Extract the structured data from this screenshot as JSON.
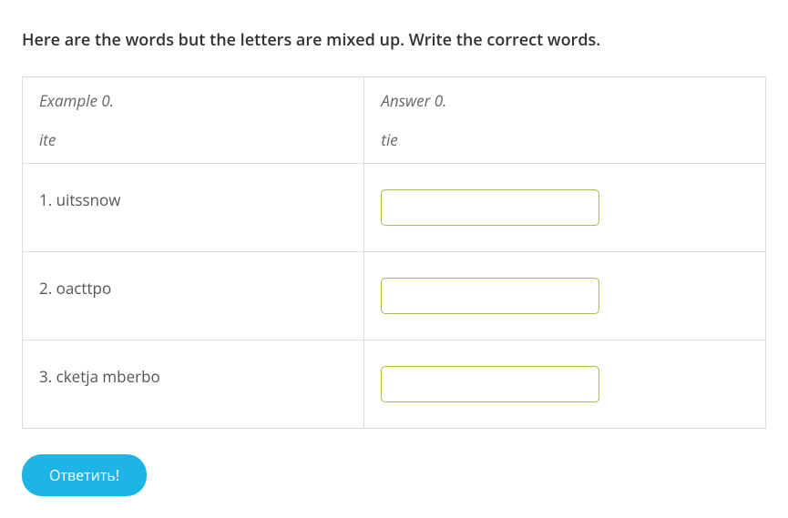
{
  "instructions": "Here are the words but the letters are mixed up. Write the correct words.",
  "example": {
    "left_label": "Example 0.",
    "left_word": "ite",
    "right_label": "Answer 0.",
    "right_word": "tie"
  },
  "questions": {
    "q1": {
      "label": "1. uitssnow",
      "value": ""
    },
    "q2": {
      "label": "2. oacttpo",
      "value": ""
    },
    "q3": {
      "label": "3. cketja mberbo",
      "value": ""
    }
  },
  "submit_label": "Ответить!"
}
